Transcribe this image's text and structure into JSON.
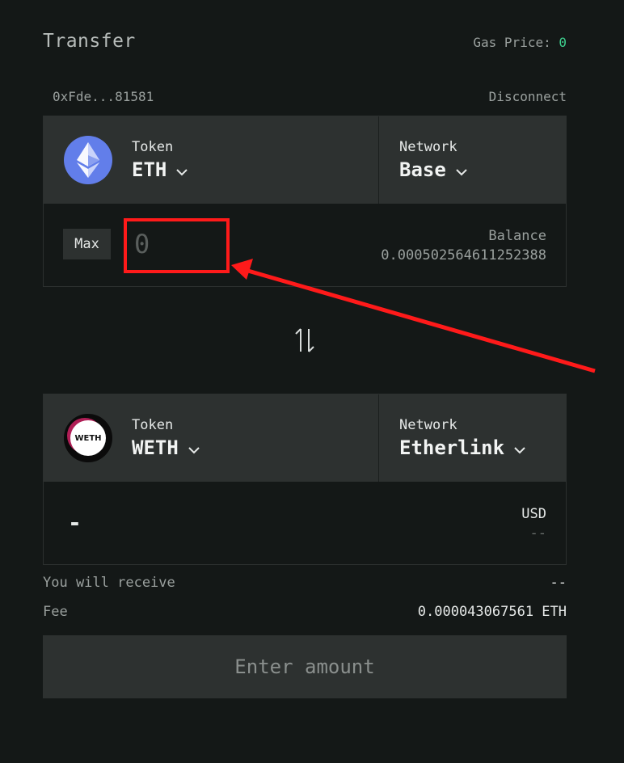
{
  "header": {
    "title": "Transfer",
    "gas_label": "Gas Price:",
    "gas_value": "0",
    "address": "0xFde...81581",
    "disconnect_label": "Disconnect"
  },
  "from": {
    "token_label": "Token",
    "token_value": "ETH",
    "token_icon": "ethereum-icon",
    "network_label": "Network",
    "network_value": "Base",
    "max_label": "Max",
    "amount_placeholder": "0",
    "balance_label": "Balance",
    "balance_value": "0.000502564611252388"
  },
  "to": {
    "token_label": "Token",
    "token_value": "WETH",
    "token_icon": "weth-icon",
    "token_icon_text": "WETH",
    "network_label": "Network",
    "network_value": "Etherlink",
    "amount_value": "-",
    "usd_label": "USD",
    "usd_value": "--"
  },
  "summary": {
    "receive_label": "You will receive",
    "receive_value": "--",
    "fee_label": "Fee",
    "fee_value": "0.000043067561 ETH"
  },
  "cta_label": "Enter amount",
  "colors": {
    "background": "#141817",
    "panel": "#2d3130",
    "accent_green": "#3ecf8e",
    "annotation_red": "#ff1a1a"
  }
}
